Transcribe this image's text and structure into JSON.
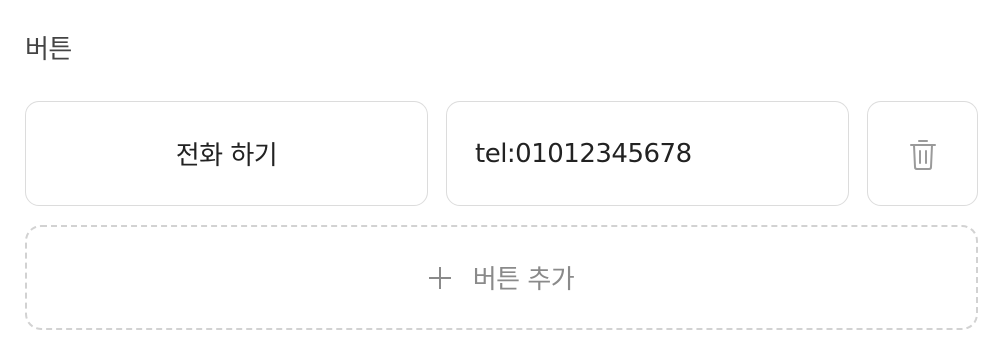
{
  "section": {
    "label": "버튼"
  },
  "button_row": {
    "label_value": "전화 하기",
    "link_value": "tel:01012345678",
    "delete_icon": "trash-icon"
  },
  "add_button": {
    "icon": "plus-icon",
    "label": "버튼 추가"
  },
  "colors": {
    "border": "#dcdcdc",
    "dashed_border": "#d2d2d2",
    "muted_text": "#8a8a8a",
    "icon": "#9a9a9a"
  }
}
